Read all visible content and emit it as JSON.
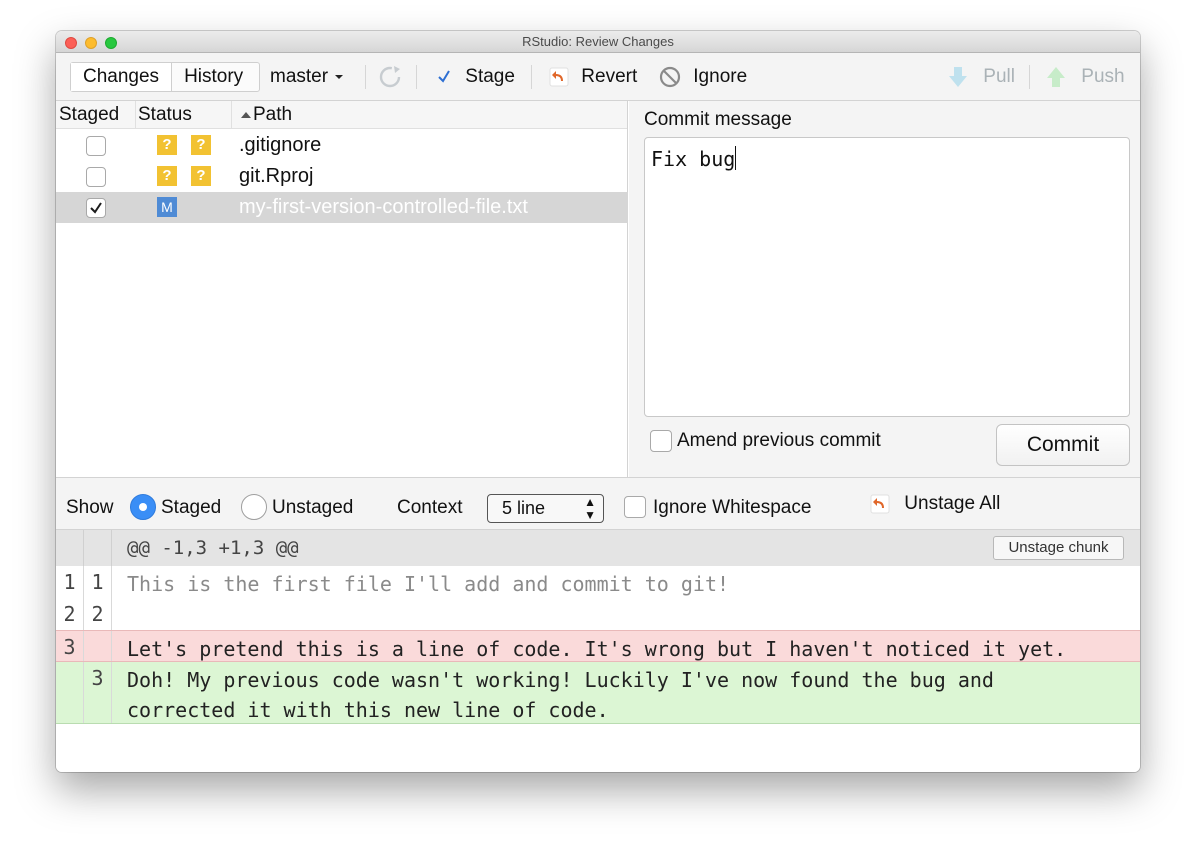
{
  "window": {
    "title": "RStudio: Review Changes"
  },
  "toolbar": {
    "tabs": [
      "Changes",
      "History"
    ],
    "branch": "master",
    "stage_label": "Stage",
    "revert_label": "Revert",
    "ignore_label": "Ignore",
    "pull_label": "Pull",
    "push_label": "Push"
  },
  "file_list": {
    "headers": {
      "staged": "Staged",
      "status": "Status",
      "path": "Path"
    },
    "rows": [
      {
        "path": ".gitignore",
        "staged": false,
        "status": [
          "?",
          "?"
        ],
        "selected": false
      },
      {
        "path": "git.Rproj",
        "staged": false,
        "status": [
          "?",
          "?"
        ],
        "selected": false
      },
      {
        "path": "my-first-version-controlled-file.txt",
        "staged": true,
        "status": [
          "M"
        ],
        "selected": true
      }
    ]
  },
  "commit": {
    "label": "Commit message",
    "message": "Fix bug",
    "amend_label": "Amend previous commit",
    "amend_checked": false,
    "button_label": "Commit"
  },
  "options": {
    "show_label": "Show",
    "staged_label": "Staged",
    "unstaged_label": "Unstaged",
    "selected_view": "Staged",
    "context_label": "Context",
    "context_value": "5 line",
    "ignore_ws_label": "Ignore Whitespace",
    "unstage_all_label": "Unstage All"
  },
  "diff": {
    "hunk_header": "@@ -1,3 +1,3 @@",
    "unstage_chunk_label": "Unstage chunk",
    "lines": [
      {
        "type": "context",
        "old": "1",
        "new": "1",
        "text": "This is the first file I'll add and commit to git!"
      },
      {
        "type": "context",
        "old": "2",
        "new": "2",
        "text": ""
      },
      {
        "type": "deletion",
        "old": "3",
        "new": "",
        "text": "Let's pretend this is a line of code. It's wrong but I haven't noticed it yet."
      },
      {
        "type": "addition",
        "old": "",
        "new": "3",
        "text": "Doh! My previous code wasn't working! Luckily I've now found the bug and\ncorrected it with this new line of code."
      }
    ]
  },
  "colors": {
    "staged_radio": "#3a8ef6",
    "untracked_status": "#f2c232",
    "modified_status": "#4f8bd5",
    "deletion_bg": "#fadada",
    "addition_bg": "#dcf6d4"
  }
}
